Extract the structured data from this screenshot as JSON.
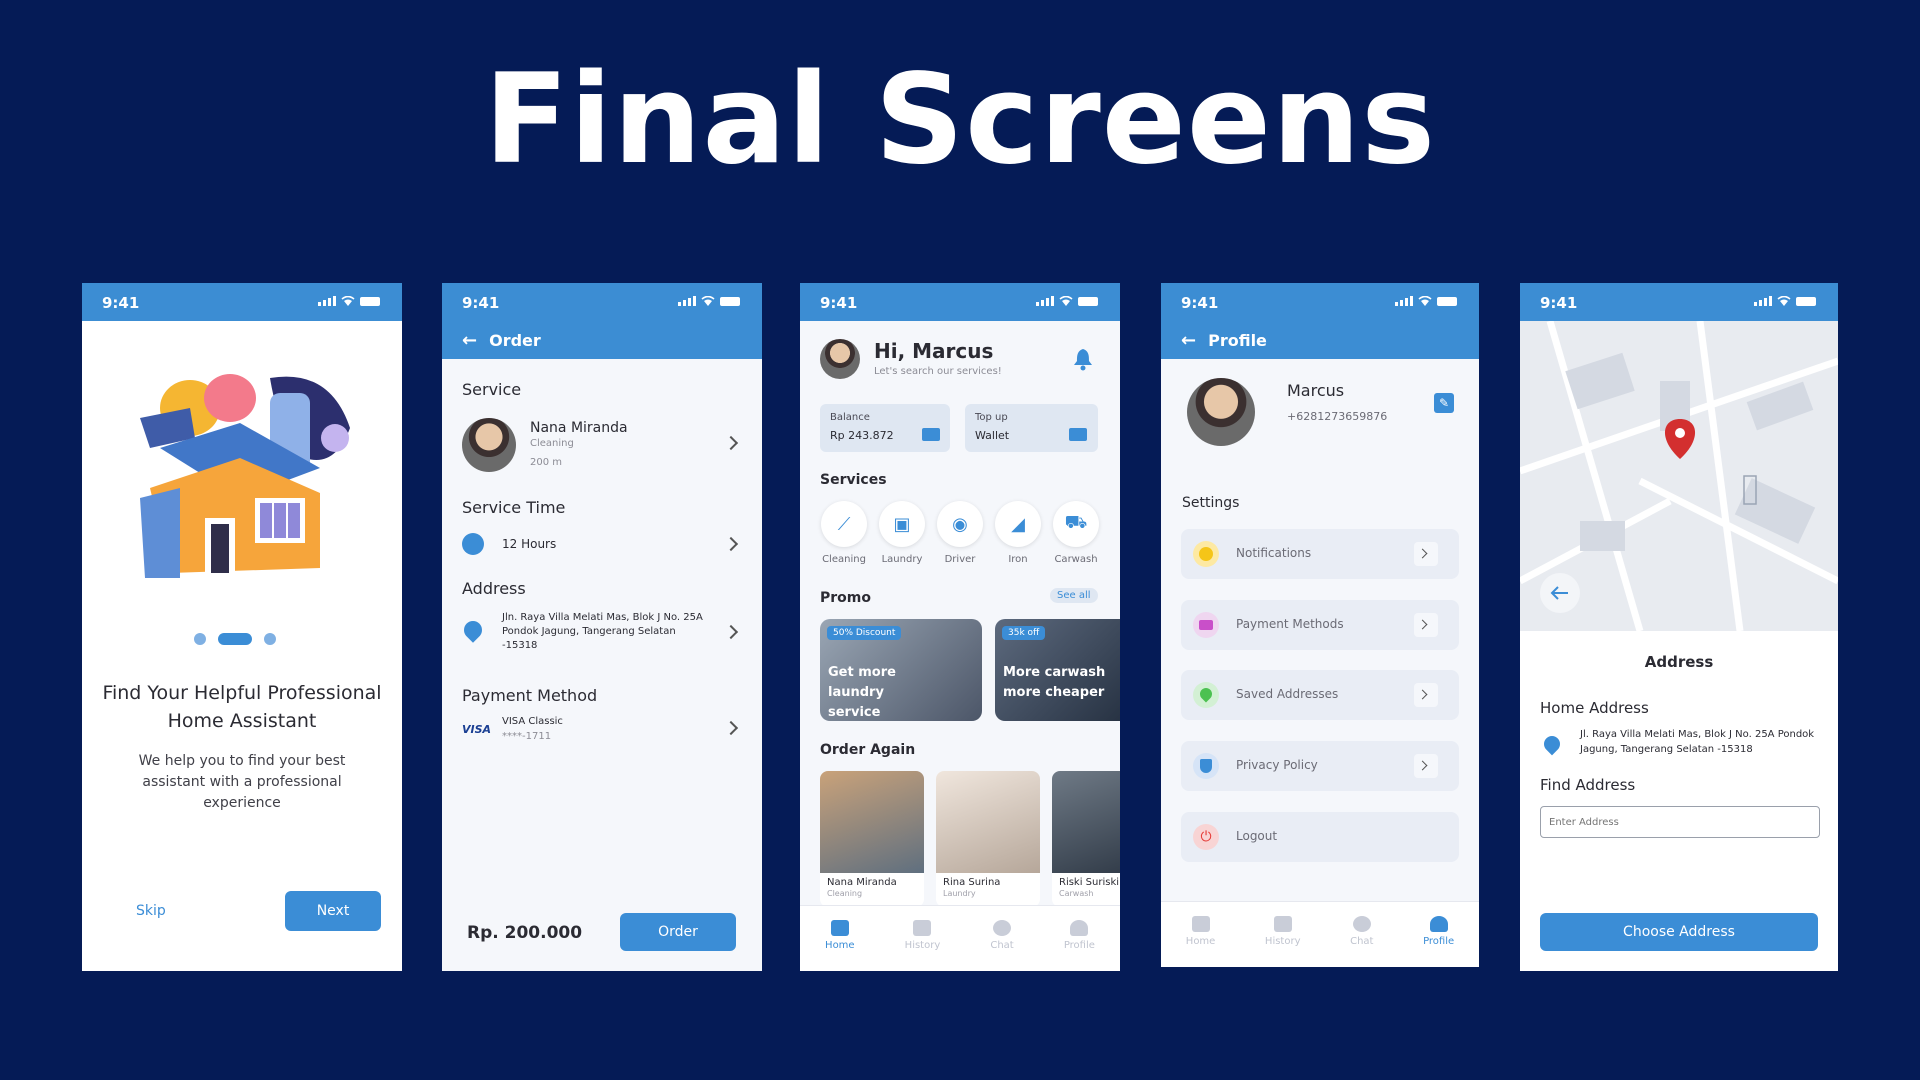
{
  "title": "Final Screens",
  "status": {
    "time": "9:41"
  },
  "onboarding": {
    "heading": "Find Your Helpful Professional Home Assistant",
    "body": "We help you to find your best assistant with a professional experience",
    "skip": "Skip",
    "next": "Next"
  },
  "order": {
    "appbar": "Order",
    "service_label": "Service",
    "provider_name": "Nana Miranda",
    "provider_type": "Cleaning",
    "provider_distance": "200 m",
    "time_label": "Service Time",
    "time_value": "12 Hours",
    "address_label": "Address",
    "address_value": "Jln. Raya Villa Melati Mas, Blok J No. 25A Pondok Jagung, Tangerang Selatan -15318",
    "payment_label": "Payment Method",
    "card_brand": "VISA",
    "card_name": "VISA Classic",
    "card_number": "****-1711",
    "price": "Rp. 200.000",
    "order_button": "Order"
  },
  "home": {
    "greeting": "Hi, Marcus",
    "subtitle": "Let's search our services!",
    "balance_label": "Balance",
    "balance_value": "Rp 243.872",
    "topup_label": "Top up",
    "topup_value": "Wallet",
    "services_label": "Services",
    "services": [
      {
        "label": "Cleaning",
        "icon": "broom-icon"
      },
      {
        "label": "Laundry",
        "icon": "washer-icon"
      },
      {
        "label": "Driver",
        "icon": "car-icon"
      },
      {
        "label": "Iron",
        "icon": "iron-icon"
      },
      {
        "label": "Carwash",
        "icon": "carwash-icon"
      }
    ],
    "promo_label": "Promo",
    "see_all": "See all",
    "promos": [
      {
        "badge": "50% Discount",
        "text": "Get more laundry service"
      },
      {
        "badge": "35k off",
        "text": "More carwash more cheaper"
      }
    ],
    "order_again_label": "Order Again",
    "order_again": [
      {
        "name": "Nana Miranda",
        "type": "Cleaning"
      },
      {
        "name": "Rina Surina",
        "type": "Laundry"
      },
      {
        "name": "Riski Suriski",
        "type": "Carwash"
      }
    ],
    "nav": [
      "Home",
      "History",
      "Chat",
      "Profile"
    ]
  },
  "profile": {
    "appbar": "Profile",
    "name": "Marcus",
    "phone": "+6281273659876",
    "settings_label": "Settings",
    "items": [
      "Notifications",
      "Payment Methods",
      "Saved Addresses",
      "Privacy Policy",
      "Logout"
    ],
    "nav": [
      "Home",
      "History",
      "Chat",
      "Profile"
    ]
  },
  "address": {
    "title": "Address",
    "home_label": "Home Address",
    "home_value": "Jl. Raya Villa Melati Mas, Blok J No. 25A Pondok Jagung, Tangerang Selatan -15318",
    "find_label": "Find Address",
    "input_placeholder": "Enter Address",
    "button": "Choose Address"
  },
  "colors": {
    "bg": "#051b56",
    "primary": "#3c8dd3"
  }
}
